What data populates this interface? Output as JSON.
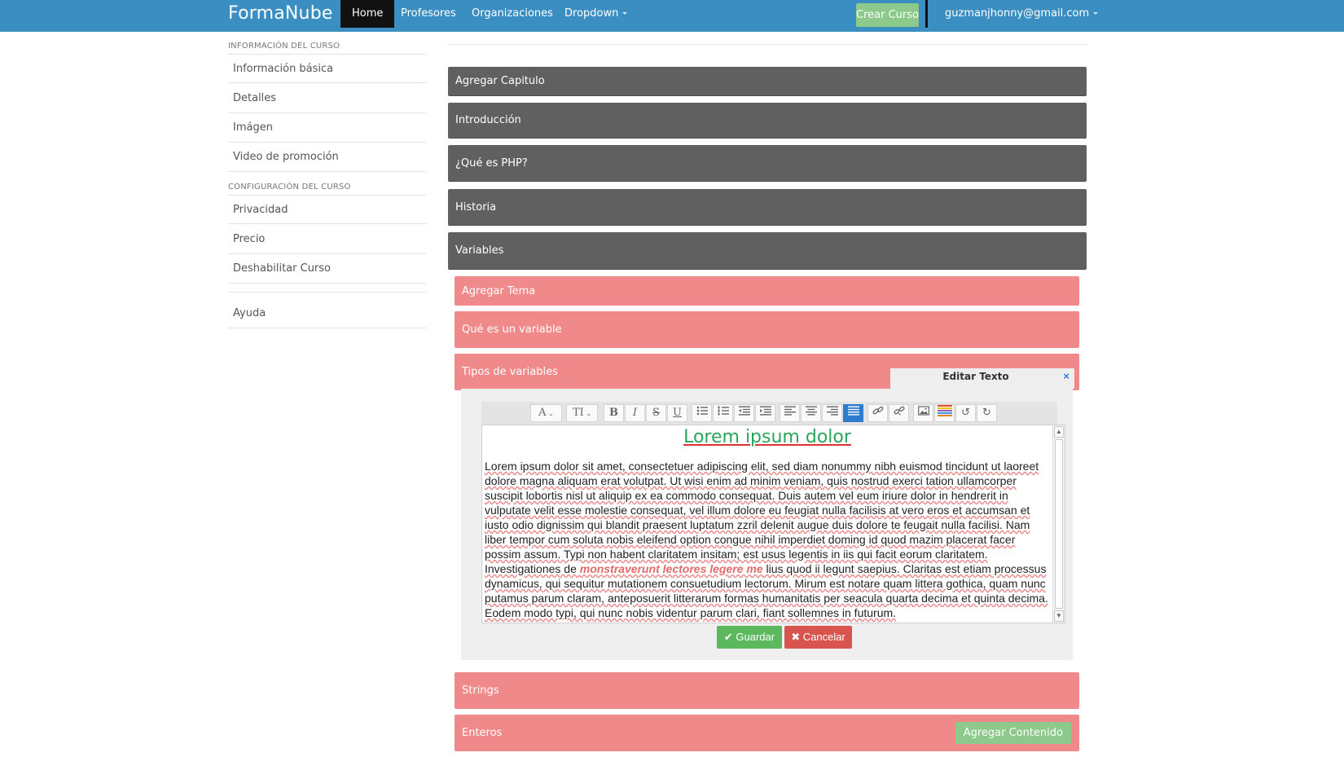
{
  "navbar": {
    "brand": "FormaNube",
    "items": [
      {
        "label": "Home"
      },
      {
        "label": "Profesores"
      },
      {
        "label": "Organizaciones"
      },
      {
        "label": "Dropdown"
      }
    ],
    "crear_curso": "Crear Curso",
    "user_email": "guzmanjhonny@gmail.com"
  },
  "sidebar": {
    "section1_title": "INFORMACIÓN DEL CURSO",
    "section1_items": [
      {
        "label": "Información básica"
      },
      {
        "label": "Detalles"
      },
      {
        "label": "Imágen"
      },
      {
        "label": "Video de promoción"
      }
    ],
    "section2_title": "CONFIGURACIÓN DEL CURSO",
    "section2_items": [
      {
        "label": "Privacidad"
      },
      {
        "label": "Precio"
      },
      {
        "label": "Deshabilitar Curso"
      }
    ],
    "help": "Ayuda"
  },
  "chapters": [
    {
      "label": "Agregar Capitulo"
    },
    {
      "label": "Introducción"
    },
    {
      "label": "¿Qué es PHP?"
    },
    {
      "label": "Historia"
    },
    {
      "label": "Variables"
    }
  ],
  "topics": [
    {
      "label": "Agregar Tema"
    },
    {
      "label": "Qué es un variable"
    },
    {
      "label": "Tipos de variables"
    },
    {
      "label": "Strings"
    },
    {
      "label": "Enteros"
    }
  ],
  "agregar_contenido": "Agregar Contenido",
  "editor": {
    "title": "Editar Texto",
    "close": "×",
    "heading": "Lorem ipsum dolor",
    "body_before": "Lorem ipsum dolor sit amet, consectetuer adipiscing elit, sed diam nonummy nibh euismod tincidunt ut laoreet dolore magna aliquam erat volutpat. Ut wisi enim ad minim veniam, quis nostrud exerci tation ullamcorper suscipit lobortis nisl ut aliquip ex ea commodo consequat. Duis autem vel eum iriure dolor in hendrerit in vulputate velit esse molestie consequat, vel illum dolore eu feugiat nulla facilisis at vero eros et accumsan et iusto odio dignissim qui blandit praesent luptatum zzril delenit augue duis dolore te feugait nulla facilisi. Nam liber tempor cum soluta nobis eleifend option congue nihil imperdiet doming id quod mazim placerat facer possim assum. Typi non habent claritatem insitam; est usus legentis in iis qui facit eorum claritatem. Investigationes de ",
    "body_highlight": "monstraverunt lectores legere me",
    "body_after": " lius quod ii legunt saepius. Claritas est etiam processus dynamicus, qui sequitur mutationem consuetudium lectorum. Mirum est notare quam littera gothica, quam nunc putamus parum claram, anteposuerit litterarum formas humanitatis per seacula quarta decima et quinta decima. Eodem modo typi, qui nunc nobis videntur parum clari, fiant sollemnes in futurum.",
    "toolbar": {
      "font_glyph": "A",
      "size_glyph": "TI",
      "bold": "B",
      "italic": "I",
      "strike": "S",
      "underline": "U"
    },
    "save": "Guardar",
    "cancel": "Cancelar"
  },
  "colors": {
    "navbar": "#3b8ec2",
    "chapter": "#606060",
    "topic": "#f08989",
    "success": "#5cb85c",
    "danger": "#d9534f",
    "heading_green": "#2aa55a"
  }
}
